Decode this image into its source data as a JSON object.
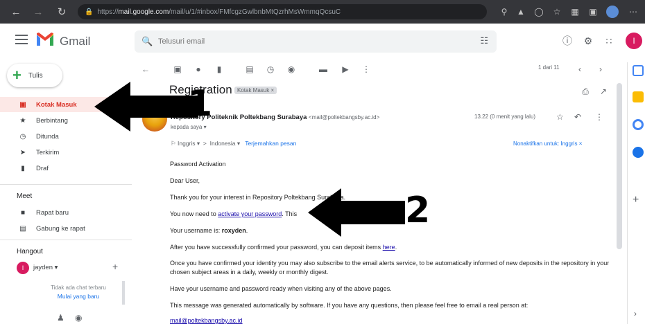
{
  "browser": {
    "url_domain": "mail.google.com",
    "url_rest": "/mail/u/1/#inbox/FMfcgzGwlbnbMtQzrhMsWmmqQcsuC",
    "url_prefix": "https://"
  },
  "app": {
    "logo_text": "Gmail",
    "brand_colors": {
      "red": "#ea4335",
      "blue": "#4285f4",
      "green": "#34a853",
      "yellow": "#fbbc04"
    }
  },
  "search": {
    "placeholder": "Telusuri email"
  },
  "header_icons": [
    "help-icon",
    "settings-icon",
    "apps-icon"
  ],
  "account_initial": "I",
  "compose_label": "Tulis",
  "nav": [
    {
      "label": "Kotak Masuk",
      "icon": "inbox-icon",
      "active": true
    },
    {
      "label": "Berbintang",
      "icon": "star-icon"
    },
    {
      "label": "Ditunda",
      "icon": "clock-icon"
    },
    {
      "label": "Terkirim",
      "icon": "send-icon"
    },
    {
      "label": "Draf",
      "icon": "draft-icon"
    }
  ],
  "meet": {
    "title": "Meet",
    "items": [
      {
        "label": "Rapat baru",
        "icon": "video-icon"
      },
      {
        "label": "Gabung ke rapat",
        "icon": "keyboard-icon"
      }
    ]
  },
  "hangout": {
    "title": "Hangout",
    "user": "jayden",
    "no_chat": "Tidak ada chat terbaru",
    "start_new": "Mulai yang baru"
  },
  "email": {
    "subject": "Registration",
    "label": "Kotak Masuk",
    "sender_name": "Repository Politeknik Poltekbang Surabaya",
    "sender_email": "<mail@poltekbangsby.ac.id>",
    "to": "kepada saya",
    "time": "13.22 (0 menit yang lalu)",
    "pager": "1 dari 11"
  },
  "translate": {
    "from": "Inggris",
    "arrow": ">",
    "to": "Indonesia",
    "action": "Terjemahkan pesan",
    "right": "Nonaktifkan untuk: Inggris"
  },
  "body": {
    "heading": "Password Activation",
    "greeting": "Dear User,",
    "thanks": "Thank you for your interest in Repository Poltekbang Surabaya.",
    "need_pre": "You now need to",
    "need_link": "activate your password",
    "need_post": ". This",
    "username_pre": "Your username is:",
    "username": "roxyden",
    "deposit_pre": "After you have successfully confirmed your password, you can deposit items",
    "deposit_link": "here",
    "alerts": "Once you have confirmed your identity you may also subscribe to the email alerts service, to be automatically informed of new deposits in the repository in your chosen subject areas in a daily, weekly or monthly digest.",
    "ready": "Have your username and password ready when visiting any of the above pages.",
    "auto": "This message was generated automatically by software. If you have any questions, then please feel free to email a real person at:",
    "contact": "mail@poltekbangsby.ac.id"
  },
  "annotations": {
    "one": "1",
    "two": "2"
  }
}
